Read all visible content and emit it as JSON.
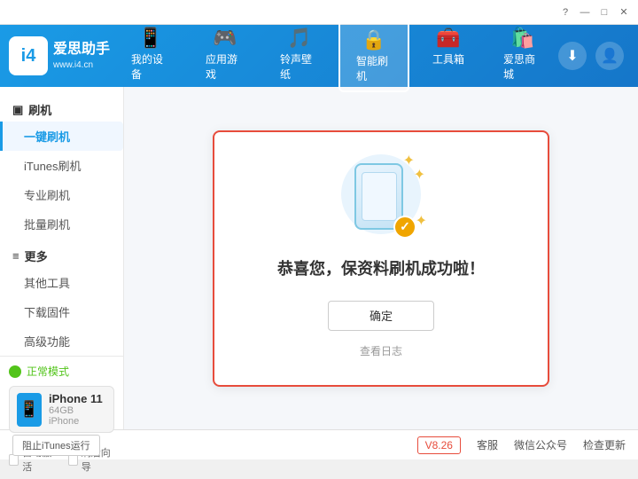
{
  "titlebar": {
    "controls": [
      "minimize",
      "maximize",
      "close"
    ]
  },
  "header": {
    "logo": {
      "brand": "爱思助手",
      "url": "www.i4.cn"
    },
    "nav": [
      {
        "id": "my-device",
        "label": "我的设备",
        "icon": "📱"
      },
      {
        "id": "apps-games",
        "label": "应用游戏",
        "icon": "🎮"
      },
      {
        "id": "ringtones",
        "label": "铃声壁纸",
        "icon": "🎵"
      },
      {
        "id": "smart-flash",
        "label": "智能刷机",
        "icon": "🔒",
        "active": true
      },
      {
        "id": "tools",
        "label": "工具箱",
        "icon": "🧰"
      },
      {
        "id": "shop",
        "label": "爱思商城",
        "icon": "🛍️"
      }
    ],
    "actions": [
      {
        "id": "download",
        "icon": "⬇"
      },
      {
        "id": "user",
        "icon": "👤"
      }
    ]
  },
  "sidebar": {
    "flash_section": "刷机",
    "flash_items": [
      {
        "id": "one-key-flash",
        "label": "一键刷机",
        "active": true
      },
      {
        "id": "itunes-flash",
        "label": "iTunes刷机"
      },
      {
        "id": "pro-flash",
        "label": "专业刷机"
      },
      {
        "id": "batch-flash",
        "label": "批量刷机"
      }
    ],
    "more_section": "更多",
    "more_items": [
      {
        "id": "other-tools",
        "label": "其他工具"
      },
      {
        "id": "download-firmware",
        "label": "下载固件"
      },
      {
        "id": "advanced",
        "label": "高级功能"
      }
    ]
  },
  "device": {
    "mode_label": "正常模式",
    "name": "iPhone 11",
    "storage": "64GB",
    "type": "iPhone",
    "auto_activate_label": "自动激活",
    "guide_label": "刷后向导"
  },
  "footer": {
    "stop_itunes_label": "阻止iTunes运行",
    "version": "V8.26",
    "support": "客服",
    "wechat": "微信公众号",
    "check_update": "检查更新"
  },
  "success_modal": {
    "message": "恭喜您，保资料刷机成功啦！",
    "confirm_label": "确定",
    "view_log_label": "查看日志"
  }
}
